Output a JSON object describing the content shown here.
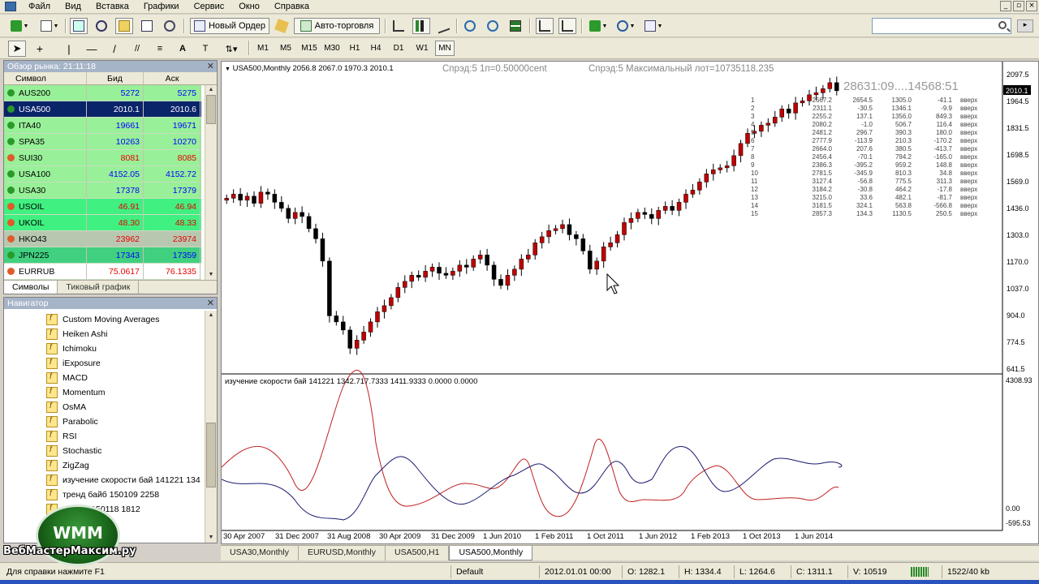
{
  "menu": [
    "Файл",
    "Вид",
    "Вставка",
    "Графики",
    "Сервис",
    "Окно",
    "Справка"
  ],
  "window_controls": [
    "_",
    "▫",
    "×"
  ],
  "toolbar": {
    "new_order": "Новый Ордер",
    "auto_trading": "Авто-торговля"
  },
  "timeframes": [
    "M1",
    "M5",
    "M15",
    "M30",
    "H1",
    "H4",
    "D1",
    "W1",
    "MN"
  ],
  "active_timeframe": "MN",
  "search": {
    "placeholder": ""
  },
  "market_watch": {
    "title": "Обзор рынка: 21:11:18",
    "columns": [
      "Символ",
      "Бид",
      "Аск"
    ],
    "rows": [
      {
        "symbol": "AUS200",
        "bid": "5272",
        "ask": "5275",
        "dir": "up",
        "bg": "#98f098"
      },
      {
        "symbol": "USA500",
        "bid": "2010.1",
        "ask": "2010.6",
        "dir": "up",
        "bg": "#0a246a",
        "selected": true
      },
      {
        "symbol": "ITA40",
        "bid": "19661",
        "ask": "19671",
        "dir": "up",
        "bg": "#98f098"
      },
      {
        "symbol": "SPA35",
        "bid": "10263",
        "ask": "10270",
        "dir": "up",
        "bg": "#98f098"
      },
      {
        "symbol": "SUI30",
        "bid": "8081",
        "ask": "8085",
        "dir": "dn",
        "bg": "#98f098"
      },
      {
        "symbol": "USA100",
        "bid": "4152.05",
        "ask": "4152.72",
        "dir": "up",
        "bg": "#98f098"
      },
      {
        "symbol": "USA30",
        "bid": "17378",
        "ask": "17379",
        "dir": "up",
        "bg": "#98f098"
      },
      {
        "symbol": "USOIL",
        "bid": "46.91",
        "ask": "46.94",
        "dir": "dn",
        "bg": "#40f080"
      },
      {
        "symbol": "UKOIL",
        "bid": "48.30",
        "ask": "48.33",
        "dir": "dn",
        "bg": "#40f080"
      },
      {
        "symbol": "HKO43",
        "bid": "23962",
        "ask": "23974",
        "dir": "dn",
        "bg": "#b8c8b0"
      },
      {
        "symbol": "JPN225",
        "bid": "17343",
        "ask": "17359",
        "dir": "up",
        "bg": "#40d080"
      },
      {
        "symbol": "EURRUB",
        "bid": "75.0617",
        "ask": "76.1335",
        "dir": "dn",
        "bg": "#ffffff"
      }
    ],
    "tabs": [
      "Символы",
      "Тиковый график"
    ]
  },
  "navigator": {
    "title": "Навигатор",
    "items": [
      "Custom Moving Averages",
      "Heiken Ashi",
      "Ichimoku",
      "iExposure",
      "MACD",
      "Momentum",
      "OsMA",
      "Parabolic",
      "RSI",
      "Stochastic",
      "ZigZag",
      "изучение скорости бай 141221 134",
      "тренд байб 150109 2258",
      "...байб 150118 1812"
    ]
  },
  "chart": {
    "title": "USA500,Monthly  2056.8 2067.0 1970.3 2010.1",
    "spread_info": "Спрэд:5  1п=0.50000cent",
    "max_lot": "Спрэд:5  Максимальный лот=10735118.235",
    "big_label": "28631:09....14568:51",
    "indicator_title": "изучение скорости бай 141221 1342.717.7333 1411.9333 0.0000 0.0000",
    "price_axis": [
      "2097.5",
      "1964.5",
      "1831.5",
      "1698.5",
      "1569.0",
      "1436.0",
      "1303.0",
      "1170.0",
      "1037.0",
      "904.0",
      "774.5",
      "641.5"
    ],
    "current_price": "2010.1",
    "indicator_axis": [
      "4308.93",
      "0.00",
      "-595.53"
    ],
    "time_axis": [
      "30 Apr 2007",
      "31 Dec 2007",
      "31 Aug 2008",
      "30 Apr 2009",
      "31 Dec 2009",
      "1 Jun 2010",
      "1 Feb 2011",
      "1 Oct 2011",
      "1 Jun 2012",
      "1 Feb 2013",
      "1 Oct 2013",
      "1 Jun 2014"
    ],
    "table_rows": [
      [
        "1",
        "2567.2",
        "2654.5",
        "1305.0",
        "-41.1",
        "вверх"
      ],
      [
        "2",
        "2311.1",
        "-30.5",
        "1346.1",
        "-9.9",
        "вверх"
      ],
      [
        "3",
        "2255.2",
        "137.1",
        "1356.0",
        "849.3",
        "вверх"
      ],
      [
        "4",
        "2080.2",
        "-1.0",
        "506.7",
        "116.4",
        "вверх"
      ],
      [
        "5",
        "2481.2",
        "296.7",
        "390.3",
        "180.0",
        "вверх"
      ],
      [
        "6",
        "2777.9",
        "-113.9",
        "210.3",
        "-170.2",
        "вверх"
      ],
      [
        "7",
        "2664.0",
        "207.6",
        "380.5",
        "-413.7",
        "вверх"
      ],
      [
        "8",
        "2456.4",
        "-70.1",
        "794.2",
        "-165.0",
        "вверх"
      ],
      [
        "9",
        "2386.3",
        "-395.2",
        "959.2",
        "148.8",
        "вверх"
      ],
      [
        "10",
        "2781.5",
        "-345.9",
        "810.3",
        "34.8",
        "вверх"
      ],
      [
        "11",
        "3127.4",
        "-56.8",
        "775.5",
        "311.3",
        "вверх"
      ],
      [
        "12",
        "3184.2",
        "-30.8",
        "464.2",
        "-17.8",
        "вверх"
      ],
      [
        "13",
        "3215.0",
        "33.6",
        "482.1",
        "-81.7",
        "вверх"
      ],
      [
        "14",
        "3181.5",
        "324.1",
        "563.8",
        "-566.8",
        "вверх"
      ],
      [
        "15",
        "2857.3",
        "134.3",
        "1130.5",
        "250.5",
        "вверх"
      ]
    ],
    "candle_closes": [
      1480,
      1500,
      1470,
      1490,
      1455,
      1510,
      1500,
      1460,
      1430,
      1380,
      1410,
      1390,
      1330,
      1280,
      1170,
      900,
      870,
      830,
      740,
      780,
      820,
      870,
      920,
      950,
      990,
      1040,
      1070,
      1100,
      1090,
      1120,
      1140,
      1110,
      1100,
      1120,
      1150,
      1140,
      1180,
      1200,
      1150,
      1080,
      1050,
      1100,
      1130,
      1180,
      1200,
      1260,
      1290,
      1320,
      1330,
      1350,
      1300,
      1280,
      1220,
      1130,
      1170,
      1240,
      1260,
      1300,
      1360,
      1380,
      1410,
      1400,
      1380,
      1420,
      1440,
      1420,
      1460,
      1500,
      1520,
      1560,
      1600,
      1620,
      1630,
      1640,
      1690,
      1750,
      1800,
      1810,
      1840,
      1850,
      1880,
      1920,
      1900,
      1950,
      1960,
      1990,
      2000,
      2020,
      2050,
      2010
    ]
  },
  "chart_tabs": [
    "USA30,Monthly",
    "EURUSD,Monthly",
    "USA500,H1",
    "USA500,Monthly"
  ],
  "status": {
    "help": "Для справки нажмите F1",
    "profile": "Default",
    "datetime": "2012.01.01 00:00",
    "open": "O: 1282.1",
    "high": "H: 1334.4",
    "low": "L: 1264.6",
    "close": "C: 1311.1",
    "volume": "V: 10519",
    "traffic": "1522/40 kb"
  },
  "logo": {
    "text": "WMM",
    "caption": "ВебМастерМаксим.ру"
  },
  "colors": {
    "bull": "#c00000",
    "bear": "#000000",
    "red_line": "#c02020",
    "blue_line": "#1a1a6e",
    "selection": "#0a246a"
  }
}
